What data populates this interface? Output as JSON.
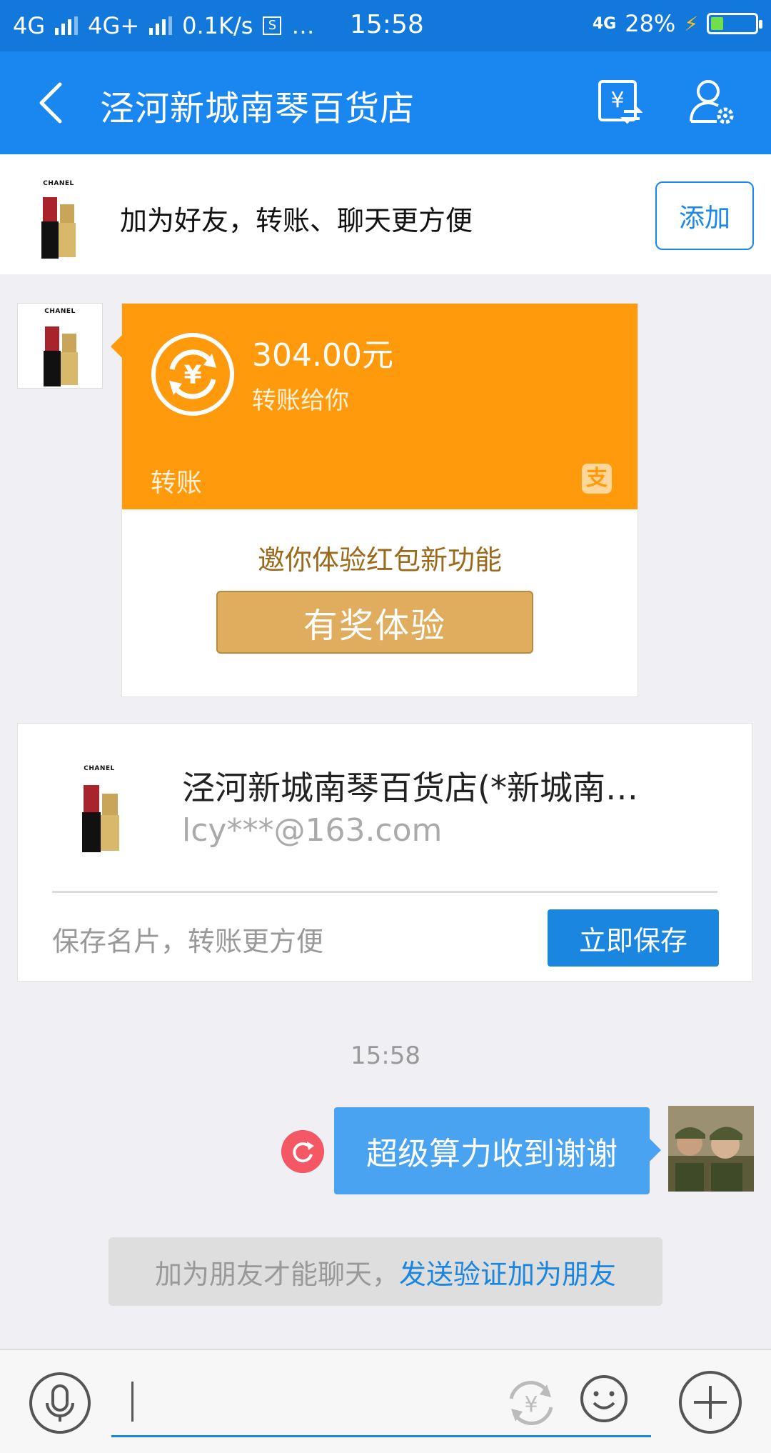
{
  "status_bar": {
    "network1": "4G",
    "network2": "4G+",
    "speed": "0.1K/s",
    "extra": "…",
    "time": "15:58",
    "volte": "4G",
    "battery": "28%",
    "battery_level": 0.28
  },
  "header": {
    "title": "泾河新城南琴百货店"
  },
  "add_banner": {
    "brand": "CHANEL",
    "text": "加为好友，转账、聊天更方便",
    "button": "添加"
  },
  "transfer_card": {
    "brand": "CHANEL",
    "amount": "304.00元",
    "subtitle": "转账给你",
    "label": "转账",
    "logo_char": "支",
    "invite": "邀你体验红包新功能",
    "prize_button": "有奖体验"
  },
  "name_card": {
    "brand": "CHANEL",
    "name": "泾河新城南琴百货店(*新城南…",
    "email": "lcy***@163.com",
    "hint": "保存名片，转账更方便",
    "save_button": "立即保存"
  },
  "chat": {
    "timestamp": "15:58",
    "message": "超级算力收到谢谢",
    "system_prefix": "加为朋友才能聊天，",
    "system_link": "发送验证加为朋友"
  },
  "colors": {
    "header": "#1a86f0",
    "status": "#1278dc",
    "transfer": "#ff9a0d",
    "bubble": "#4aa3f0",
    "link": "#1a86e0"
  }
}
